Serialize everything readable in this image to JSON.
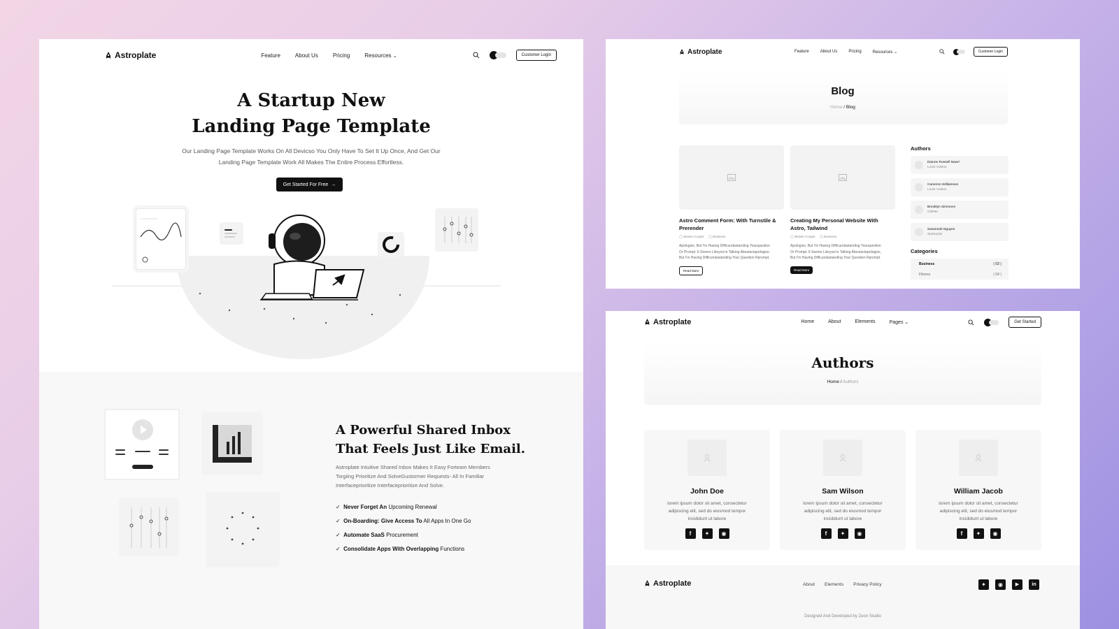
{
  "brand": "Astroplate",
  "landing": {
    "menu": [
      "Feature",
      "About Us",
      "Pricing",
      "Resources"
    ],
    "login": "Customer Login",
    "hero_line1": "A Startup New",
    "hero_line2": "Landing Page Template",
    "hero_sub1": "Our Landing Page Template Works On All Devicso You Only Have To Set It Up Once, And Get Our",
    "hero_sub2": "Landing Page Template Work All Makes The Entire Process Effortless.",
    "cta": "Get Started For Free",
    "inbox_line1": "A Powerful Shared Inbox",
    "inbox_line2": "That Feels Just Like Email.",
    "inbox_desc1": "Astroplate Intuitive Shared Inbox Makes It Easy Forteam Members",
    "inbox_desc2": "Torgiing Prioritize And SolveGustormer Requests- All In Familiar",
    "inbox_desc3": "Interfaceprioritize Interfaceprioritize And Solve.",
    "features": [
      {
        "bold": "Never Forget An",
        "rest": " Upcoming Renewal"
      },
      {
        "bold": "On-Boarding: Give Access To",
        "rest": " All Apps In One Go"
      },
      {
        "bold": "Automate SaaS",
        "rest": " Procurement"
      },
      {
        "bold": "Consolidate Apps With Overlapping",
        "rest": " Functions"
      }
    ]
  },
  "blog": {
    "menu": [
      "Feature",
      "About Us",
      "Pricing",
      "Resources"
    ],
    "login": "Customer Login",
    "title": "Blog",
    "crumb_home": "Home",
    "crumb_current": "Blog",
    "posts": [
      {
        "title1": "Astro Comment Form: With Turnstile &",
        "title2": "Prerender",
        "author": "Bessie Cooper",
        "category": "Business",
        "ex1": "Apologize, But I'm Having Difficundastanding Yourquestion",
        "ex2": "Or Prompt. It Seems Likeyou're Talking Aboutactapologize,",
        "ex3": "But I'm Having Difficundastanding Your Question Rprompt.",
        "button": "Read More"
      },
      {
        "title1": "Creating My Personal Website With",
        "title2": "Astro, Tailwind",
        "author": "Bessie Cooper",
        "category": "Business",
        "ex1": "Apologize, But I'm Having Difficundastanding Yourquestion",
        "ex2": "Or Prompt. It Seems Likeyou're Talking Aboutactapologize,",
        "ex3": "But I'm Having Difficundastanding Your Question Rprompt.",
        "button": "Read More"
      }
    ],
    "authors_title": "Authors",
    "authors": [
      {
        "name": "Dianne Russell Nawri",
        "company": "Louis Vuitton"
      },
      {
        "name": "Cameron Williamson",
        "company": "Louis Vuitton"
      },
      {
        "name": "Brooklyn Simmons",
        "company": "Gillette"
      },
      {
        "name": "Savannah Nguyen",
        "company": "Starbucks"
      }
    ],
    "categories_title": "Categories",
    "categories": [
      {
        "name": "Business",
        "count": "( 03 )"
      },
      {
        "name": "Fitness",
        "count": "( 04 )"
      }
    ]
  },
  "authors_page": {
    "menu": [
      "Home",
      "About",
      "Elements",
      "Pages"
    ],
    "cta": "Get Started",
    "title": "Authors",
    "crumb_home": "Home",
    "crumb_current": "Authors",
    "people": [
      {
        "name": "John Doe",
        "bio1": "lorem ipsum dolor sit amet, consectetur",
        "bio2": "adipiscing elit, sed do eiusmod tempor",
        "bio3": "incididunt ut labore"
      },
      {
        "name": "Sam Wilson",
        "bio1": "lorem ipsum dolor sit amet, consectetur",
        "bio2": "adipiscing elit, sed do eiusmod tempor",
        "bio3": "incididunt ut labore"
      },
      {
        "name": "William Jacob",
        "bio1": "lorem ipsum dolor sit amet, consectetur",
        "bio2": "adipiscing elit, sed do eiusmod tempor",
        "bio3": "incididunt ut labore"
      }
    ],
    "footer_links": [
      "About",
      "Elements",
      "Privacy Policy"
    ],
    "credit": "Designed And Developed by Zeon Studio"
  }
}
